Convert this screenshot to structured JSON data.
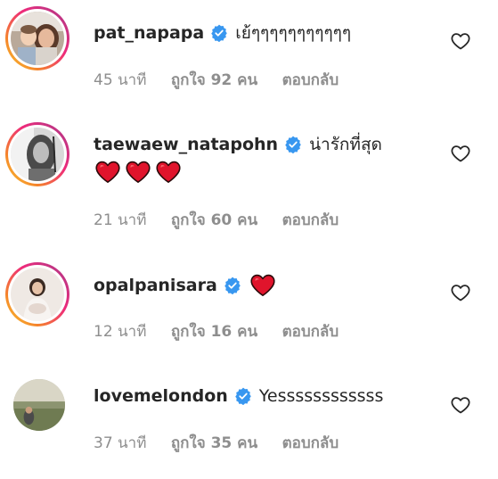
{
  "comments": [
    {
      "username": "pat_napapa",
      "text": "เย้ๆๆๆๆๆๆๆๆๆๆๆ",
      "time": "45 นาที",
      "likes": "ถูกใจ 92 คน",
      "reply": "ตอบกลับ",
      "has_story": true,
      "hearts": 0
    },
    {
      "username": "taewaew_natapohn",
      "text": "น่ารักที่สุด",
      "time": "21 นาที",
      "likes": "ถูกใจ 60 คน",
      "reply": "ตอบกลับ",
      "has_story": true,
      "hearts": 3
    },
    {
      "username": "opalpanisara",
      "text": "",
      "time": "12 นาที",
      "likes": "ถูกใจ 16 คน",
      "reply": "ตอบกลับ",
      "has_story": true,
      "hearts": 1
    },
    {
      "username": "lovemelondon",
      "text": "Yessssssssssss",
      "time": "37 นาที",
      "likes": "ถูกใจ 35 คน",
      "reply": "ตอบกลับ",
      "has_story": false,
      "hearts": 0
    }
  ],
  "icons": {
    "verified": "verified-badge-icon",
    "like": "heart-outline-icon",
    "emoji": "red-heart-emoji"
  },
  "colors": {
    "verified_blue": "#3897f0",
    "text": "#262626",
    "meta": "#8e8e8e",
    "emoji_heart": "#e0142c"
  }
}
